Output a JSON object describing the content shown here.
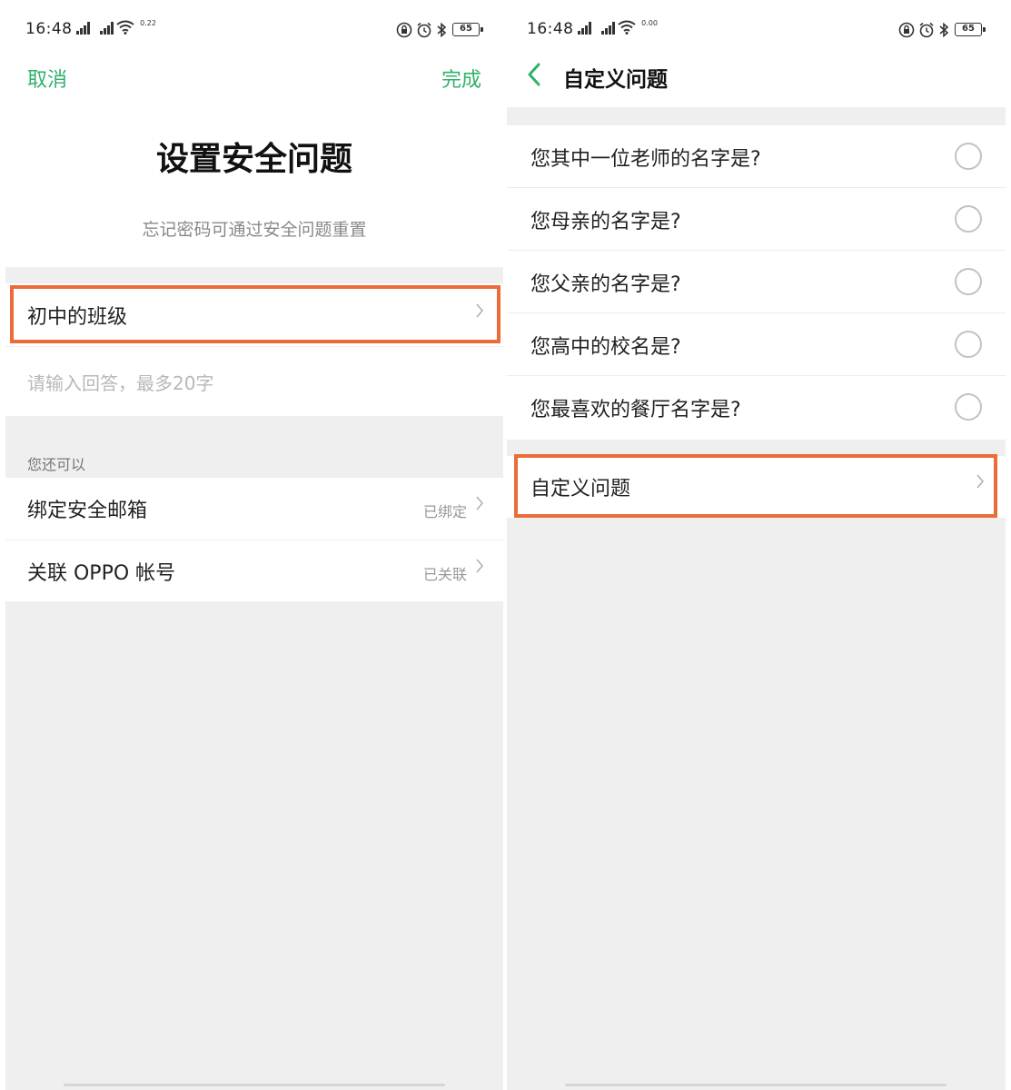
{
  "status_bar": {
    "time": "16:48",
    "signal_1": "ᵃᵢₗ",
    "signal_2": "ᵃᵢₗ",
    "speed_left": "0.22",
    "speed_right": "0.00",
    "battery": "65",
    "icons": [
      "wifi-icon",
      "lock-rotation-icon",
      "alarm-icon",
      "bluetooth-icon"
    ]
  },
  "left_screen": {
    "cancel_label": "取消",
    "done_label": "完成",
    "title": "设置安全问题",
    "subtitle": "忘记密码可通过安全问题重置",
    "selected_question": "初中的班级",
    "answer_placeholder": "请输入回答，最多20字",
    "section_label": "您还可以",
    "options": [
      {
        "label": "绑定安全邮箱",
        "status": "已绑定"
      },
      {
        "label": "关联 OPPO 帐号",
        "status": "已关联"
      }
    ]
  },
  "right_screen": {
    "nav_title": "自定义问题",
    "questions": [
      "您其中一位老师的名字是?",
      "您母亲的名字是?",
      "您父亲的名字是?",
      "您高中的校名是?",
      "您最喜欢的餐厅名字是?"
    ],
    "custom_label": "自定义问题"
  },
  "colors": {
    "accent_green": "#2fb26a",
    "highlight_orange": "#ec6b3a",
    "background_gray": "#efefef"
  }
}
